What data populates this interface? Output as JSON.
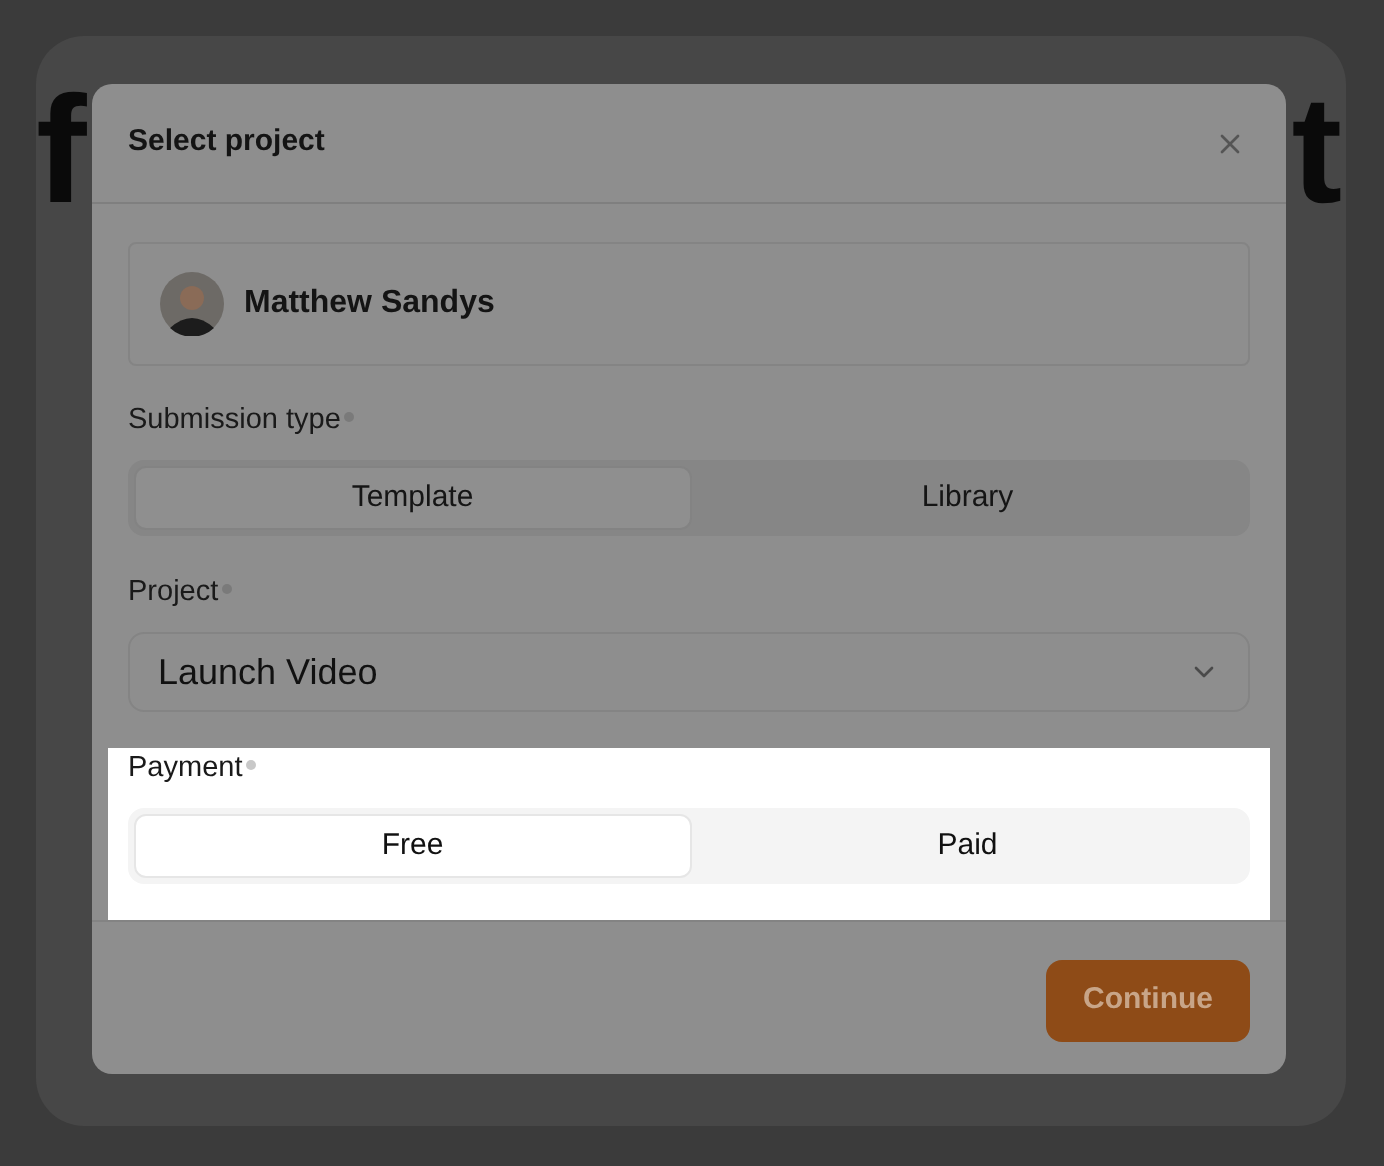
{
  "background": {
    "heading_left": "f",
    "heading_right": "t"
  },
  "dialog": {
    "title": "Select project",
    "user": {
      "name": "Matthew Sandys"
    },
    "fields": [
      {
        "kind": "segmented",
        "label": "Submission type",
        "required": true,
        "spotlight": false,
        "options": [
          {
            "label": "Template",
            "selected": true
          },
          {
            "label": "Library",
            "selected": false
          }
        ]
      },
      {
        "kind": "select",
        "label": "Project",
        "required": true,
        "spotlight": false,
        "value": "Launch Video"
      },
      {
        "kind": "segmented",
        "label": "Payment",
        "required": true,
        "spotlight": true,
        "options": [
          {
            "label": "Free",
            "selected": true
          },
          {
            "label": "Paid",
            "selected": false
          }
        ]
      }
    ],
    "primary_button": "Continue"
  }
}
